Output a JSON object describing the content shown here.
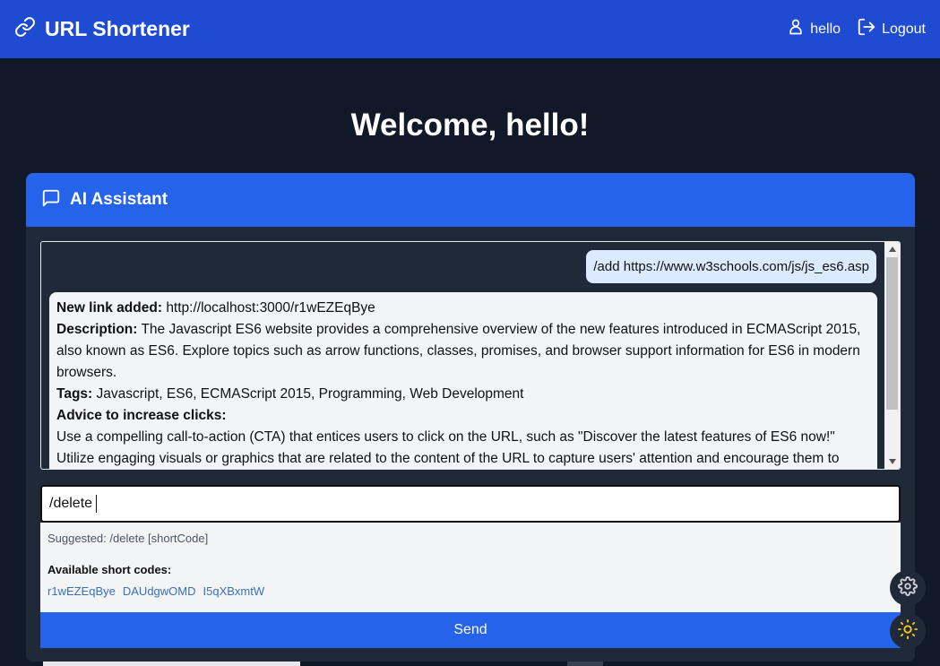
{
  "app": {
    "title": "URL Shortener"
  },
  "nav": {
    "user_label": "hello",
    "logout_label": "Logout"
  },
  "welcome": {
    "heading": "Welcome, hello!"
  },
  "assistant": {
    "title": "AI Assistant",
    "user_message": "/add https://www.w3schools.com/js/js_es6.asp",
    "bot": {
      "link_label": "New link added:",
      "link_value": "http://localhost:3000/r1wEZEqBye",
      "desc_label": "Description:",
      "desc_value": "The Javascript ES6 website provides a comprehensive overview of the new features introduced in ECMAScript 2015, also known as ES6. Explore topics such as arrow functions, classes, promises, and browser support information for ES6 in modern browsers.",
      "tags_label": "Tags:",
      "tags_value": "Javascript, ES6, ECMAScript 2015, Programming, Web Development",
      "advice_label": "Advice to increase clicks:",
      "advice_1": "Use a compelling call-to-action (CTA) that entices users to click on the URL, such as \"Discover the latest features of ES6 now!\"",
      "advice_2": "Utilize engaging visuals or graphics that are related to the content of the URL to capture users' attention and encourage them to"
    },
    "input_value": "/delete ",
    "suggestion": "Suggested: /delete [shortCode]",
    "codes_label": "Available short codes:",
    "codes": [
      "r1wEZEqBye",
      "DAUdgwOMD",
      "I5qXBxmtW"
    ],
    "send_label": "Send"
  },
  "colors": {
    "navbar": "#1e4bd2",
    "accent": "#2563eb",
    "background": "#111827",
    "card": "#1f2937",
    "sun": "#facc15"
  },
  "icons": {
    "brand": "link-icon",
    "user": "user-icon",
    "logout": "logout-icon",
    "chat": "chat-icon",
    "settings": "gear-icon",
    "theme": "sun-icon"
  }
}
